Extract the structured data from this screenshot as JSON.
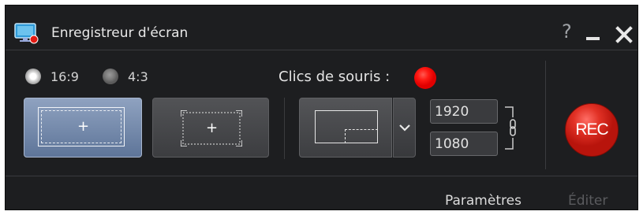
{
  "window": {
    "title": "Enregistreur d'écran",
    "help_label": "?",
    "minimize_label": "minimize",
    "close_label": "close"
  },
  "aspect": {
    "options": [
      {
        "label": "16:9",
        "selected": true
      },
      {
        "label": "4:3",
        "selected": false
      }
    ]
  },
  "mouse_clicks": {
    "label": "Clics de souris :",
    "color": "#ff1a14"
  },
  "region": {
    "fullscreen_plus": "+",
    "custom_plus": "+"
  },
  "resolution": {
    "width": "1920",
    "height": "1080",
    "linked": true
  },
  "record": {
    "label": "REC",
    "color": "#d42a20"
  },
  "footer": {
    "settings_label": "Paramètres",
    "edit_label": "Éditer",
    "edit_enabled": false
  },
  "icons": {
    "app": "screen-recorder-icon",
    "dropdown": "chevron-down-icon",
    "link": "chain-link-icon"
  }
}
